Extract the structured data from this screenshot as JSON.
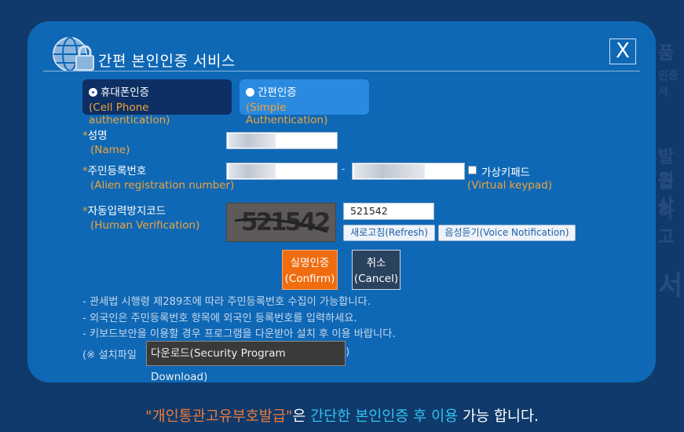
{
  "modal": {
    "title": "간편 본인인증 서비스",
    "close_label": "X"
  },
  "tabs": [
    {
      "label": "휴대폰인증",
      "sub": "(Cell Phone authentication)"
    },
    {
      "label": "간편인증",
      "sub": "(Simple Authentication)"
    }
  ],
  "form": {
    "name_label": "성명",
    "name_sub": "(Name)",
    "id_label": "주민등록번호",
    "id_sub": "(Alien registration number)",
    "id_separator": "-",
    "keypad_label": "가상키패드",
    "keypad_sub": "(Virtual keypad)",
    "captcha_label": "자동입력방지코드",
    "captcha_sub": "(Human Verification)",
    "captcha_image_text": "521542",
    "captcha_input_value": "521542",
    "refresh_label": "새로고침(Refresh)",
    "voice_label": "음성듣기(Voice Notification)",
    "required_mark": "*"
  },
  "buttons": {
    "confirm_label": "실명인증",
    "confirm_sub": "(Confirm)",
    "cancel_label": "취소",
    "cancel_sub": "(Cancel)"
  },
  "notes": [
    "- 관세법 시행령 제289조에 따라 주민등록번호 수집이 가능합니다.",
    "- 외국인은 주민등록번호 항목에 외국인 등록번호를 입력하세요.",
    "- 키보드보안을 이용할 경우 프로그램을 다운받아 설치 후 이용 바랍니다."
  ],
  "download": {
    "prefix": "(※ 설치파일",
    "button_label": "다운로드(Security Program Download)",
    "suffix": ")"
  },
  "footer": {
    "quoted": "\"개인통관고유부호발급\"",
    "part1": "은 ",
    "highlight": "간단한 본인인증 후 이용",
    "part2": " 가능 합니다."
  },
  "background_text": [
    "품",
    "인증서",
    "발급",
    "원상",
    "하고",
    "서"
  ],
  "colors": {
    "accent_orange": "#ef6d0f",
    "modal_blue": "#0f68b5",
    "page_bg": "#103a6b",
    "highlight_cyan": "#2fc2f0"
  }
}
